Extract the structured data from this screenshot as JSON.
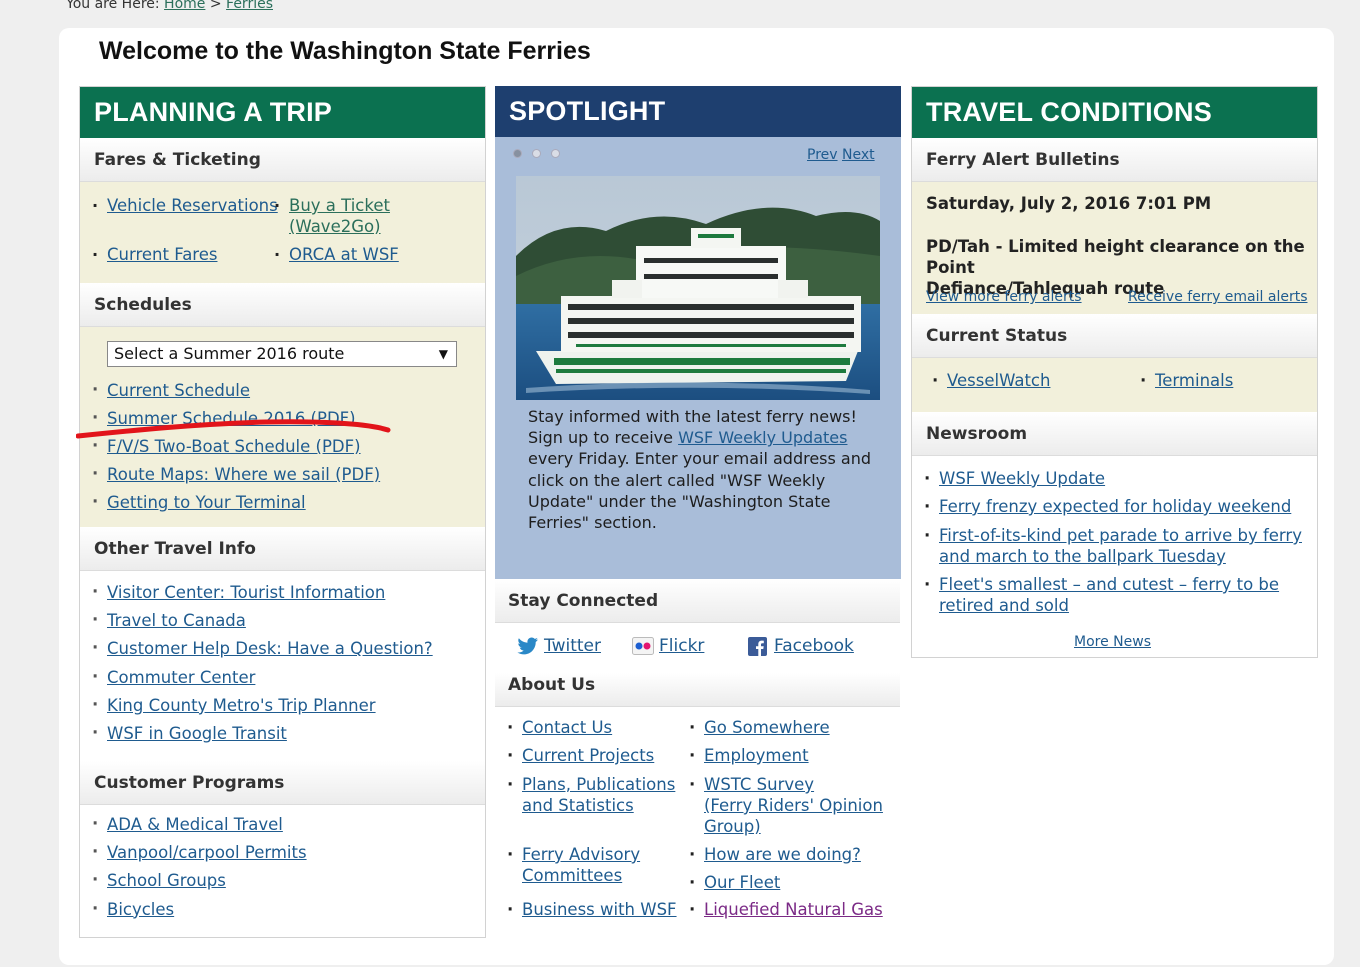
{
  "breadcrumb": {
    "prefix": "You are Here:",
    "home": "Home",
    "sep": ">",
    "current": "Ferries"
  },
  "page_title": "Welcome to the Washington State Ferries",
  "planning": {
    "header": "PLANNING A TRIP",
    "fares_title": "Fares & Ticketing",
    "fares_links": [
      "Vehicle Reservations",
      "Buy a Ticket",
      "(Wave2Go)",
      "Current Fares",
      "ORCA at WSF"
    ],
    "schedules_title": "Schedules",
    "select_value": "Select a Summer 2016 route",
    "schedule_links": [
      "Current Schedule",
      "Summer Schedule 2016 (PDF)",
      "F/V/S Two-Boat Schedule (PDF)",
      "Route Maps: Where we sail (PDF)",
      "Getting to Your Terminal"
    ],
    "other_title": "Other Travel Info",
    "other_links": [
      "Visitor Center: Tourist Information",
      "Travel to Canada",
      "Customer Help Desk: Have a Question?",
      "Commuter Center",
      "King County Metro's Trip Planner",
      "WSF in Google Transit"
    ],
    "programs_title": "Customer Programs",
    "program_links": [
      "ADA & Medical Travel",
      "Vanpool/carpool Permits",
      "School Groups",
      "Bicycles"
    ]
  },
  "spotlight": {
    "header": "SPOTLIGHT",
    "prev": "Prev",
    "next": "Next",
    "text_1": "Stay informed with the latest ferry news!",
    "text_2": "Sign up to receive",
    "weekly_link": "WSF Weekly Updates",
    "text_3": "every Friday.  Enter your email address and",
    "text_4": "click on the alert called \"WSF Weekly",
    "text_5": "Update\" under the \"Washington State",
    "text_6": "Ferries\" section."
  },
  "stay_connected": {
    "title": "Stay Connected",
    "twitter": "Twitter",
    "flickr": "Flickr",
    "facebook": "Facebook"
  },
  "about": {
    "title": "About Us",
    "left": [
      "Contact Us",
      "Current Projects",
      "Plans, Publications",
      "and Statistics",
      "Ferry Advisory",
      "Committees",
      "Business with WSF"
    ],
    "right": [
      "Go Somewhere",
      "Employment",
      "WSTC Survey",
      "(Ferry Riders' Opinion",
      "Group)",
      "How are we doing?",
      "Our Fleet",
      "Liquefied Natural Gas"
    ]
  },
  "travel": {
    "header": "TRAVEL CONDITIONS",
    "alerts_title": "Ferry Alert Bulletins",
    "alert_date": "Saturday, July 2, 2016 7:01 PM",
    "alert_text_1": "PD/Tah - Limited height clearance on the Point",
    "alert_text_2": "Defiance/Tahlequah route",
    "view_more": "View more ferry alerts",
    "receive": "Receive ferry email alerts",
    "status_title": "Current Status",
    "vesselwatch": "VesselWatch",
    "terminals": "Terminals",
    "newsroom_title": "Newsroom",
    "news": [
      "WSF Weekly Update",
      "Ferry frenzy expected for holiday weekend",
      "First-of-its-kind pet parade to arrive by ferry",
      "and march to the ballpark Tuesday",
      "Fleet's smallest – and cutest – ferry to be",
      "retired and sold"
    ],
    "more_news": "More News"
  },
  "colors": {
    "green": "#0b7150",
    "blue": "#1e3f6f",
    "beige": "#f2f0db",
    "spotlight_bg": "#a9bdd9",
    "link": "#1f5b8f"
  }
}
